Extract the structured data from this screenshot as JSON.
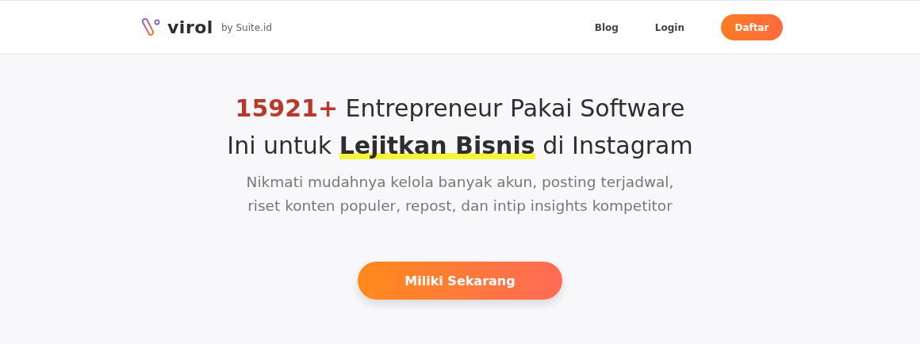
{
  "header": {
    "logo": {
      "name": "virol",
      "byline": "by Suite.id"
    },
    "nav": [
      {
        "label": "Blog",
        "kind": "link"
      },
      {
        "label": "Login",
        "kind": "link"
      },
      {
        "label": "Daftar",
        "kind": "button"
      }
    ]
  },
  "hero": {
    "headline": [
      "**15921+** Entrepreneur Pakai Software",
      "Ini untuk **Lejitkan Bisnis** di Instagram"
    ],
    "subtitle": [
      "Nikmati mudahnya kelola banyak akun, posting terjadwal,",
      "riset konten populer, repost, dan intip insights kompetitor"
    ],
    "cta": "Miliki Sekarang"
  }
}
